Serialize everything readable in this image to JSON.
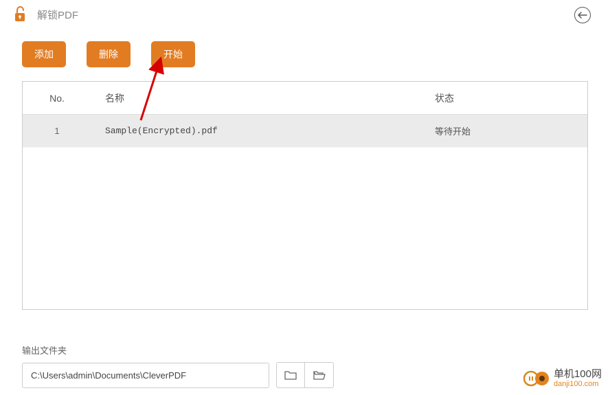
{
  "header": {
    "title": "解锁PDF"
  },
  "buttons": {
    "add": "添加",
    "delete": "删除",
    "start": "开始"
  },
  "table": {
    "headers": {
      "no": "No.",
      "name": "名称",
      "status": "状态"
    },
    "rows": [
      {
        "no": "1",
        "name": "Sample(Encrypted).pdf",
        "status": "等待开始"
      }
    ]
  },
  "output": {
    "label": "输出文件夹",
    "path": "C:\\Users\\admin\\Documents\\CleverPDF"
  },
  "watermark": {
    "line1": "单机100网",
    "line2": "danji100.com"
  },
  "colors": {
    "accent": "#e27c23",
    "arrow_red": "#d70000"
  }
}
